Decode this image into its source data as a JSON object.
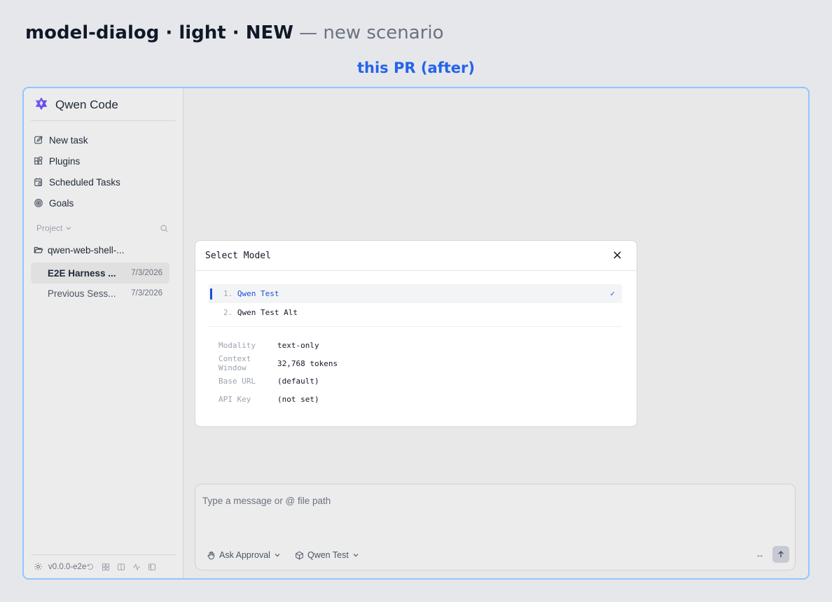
{
  "header": {
    "title_strong": "model-dialog · light · NEW",
    "dash": "—",
    "subtitle": "new scenario"
  },
  "variant_label": "this PR (after)",
  "app": {
    "brand": "Qwen Code",
    "nav": [
      {
        "label": "New task",
        "icon": "edit-icon"
      },
      {
        "label": "Plugins",
        "icon": "plugins-icon"
      },
      {
        "label": "Scheduled Tasks",
        "icon": "calendar-clock-icon"
      },
      {
        "label": "Goals",
        "icon": "target-icon"
      }
    ],
    "project_label": "Project",
    "folder": "qwen-web-shell-...",
    "sessions": [
      {
        "title": "E2E Harness ...",
        "date": "7/3/2026",
        "active": true
      },
      {
        "title": "Previous Sess...",
        "date": "7/3/2026",
        "active": false
      }
    ],
    "version": "v0.0.0-e2e"
  },
  "dialog": {
    "title": "Select Model",
    "close": "×",
    "models": [
      {
        "num": "1.",
        "name": "Qwen Test",
        "selected": true,
        "check": "✓"
      },
      {
        "num": "2.",
        "name": "Qwen Test Alt",
        "selected": false
      }
    ],
    "info": [
      {
        "key": "Modality",
        "value": "text-only"
      },
      {
        "key": "Context Window",
        "value": "32,768 tokens"
      },
      {
        "key": "Base URL",
        "value": "(default)"
      },
      {
        "key": "API Key",
        "value": "(not set)"
      }
    ]
  },
  "composer": {
    "placeholder": "Type a message or @ file path",
    "approval_mode": "Ask Approval",
    "model": "Qwen Test",
    "expand_symbol": "↔"
  },
  "colors": {
    "accent": "#2563eb",
    "selection": "#1d4ed8",
    "frame_border": "#93c5fd"
  }
}
